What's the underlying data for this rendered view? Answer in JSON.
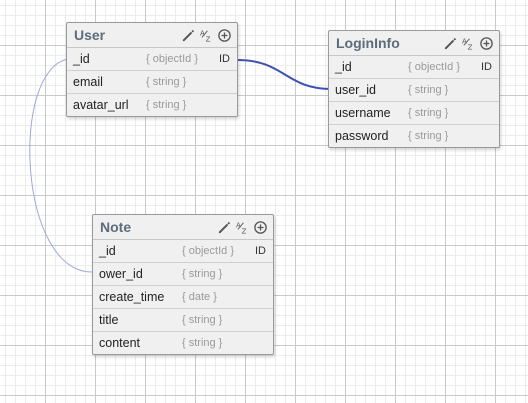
{
  "entities": {
    "user": {
      "title": "User",
      "fields": [
        {
          "name": "_id",
          "type": "{ objectId }",
          "key": "ID"
        },
        {
          "name": "email",
          "type": "{ string }",
          "key": ""
        },
        {
          "name": "avatar_url",
          "type": "{ string }",
          "key": ""
        }
      ]
    },
    "logininfo": {
      "title": "LoginInfo",
      "fields": [
        {
          "name": "_id",
          "type": "{ objectId }",
          "key": "ID"
        },
        {
          "name": "user_id",
          "type": "{ string }",
          "key": ""
        },
        {
          "name": "username",
          "type": "{ string }",
          "key": ""
        },
        {
          "name": "password",
          "type": "{ string }",
          "key": ""
        }
      ]
    },
    "note": {
      "title": "Note",
      "fields": [
        {
          "name": "_id",
          "type": "{ objectId }",
          "key": "ID"
        },
        {
          "name": "ower_id",
          "type": "{ string }",
          "key": ""
        },
        {
          "name": "create_time",
          "type": "{ date }",
          "key": ""
        },
        {
          "name": "title",
          "type": "{ string }",
          "key": ""
        },
        {
          "name": "content",
          "type": "{ string }",
          "key": ""
        }
      ]
    }
  },
  "icons": {
    "edit": "pencil-icon",
    "sort": "sort-az-icon",
    "add": "add-circle-icon"
  },
  "colors": {
    "relation_strong": "#3f51b5",
    "relation_light": "#9fa8da",
    "header_text": "#5d6c7b"
  }
}
